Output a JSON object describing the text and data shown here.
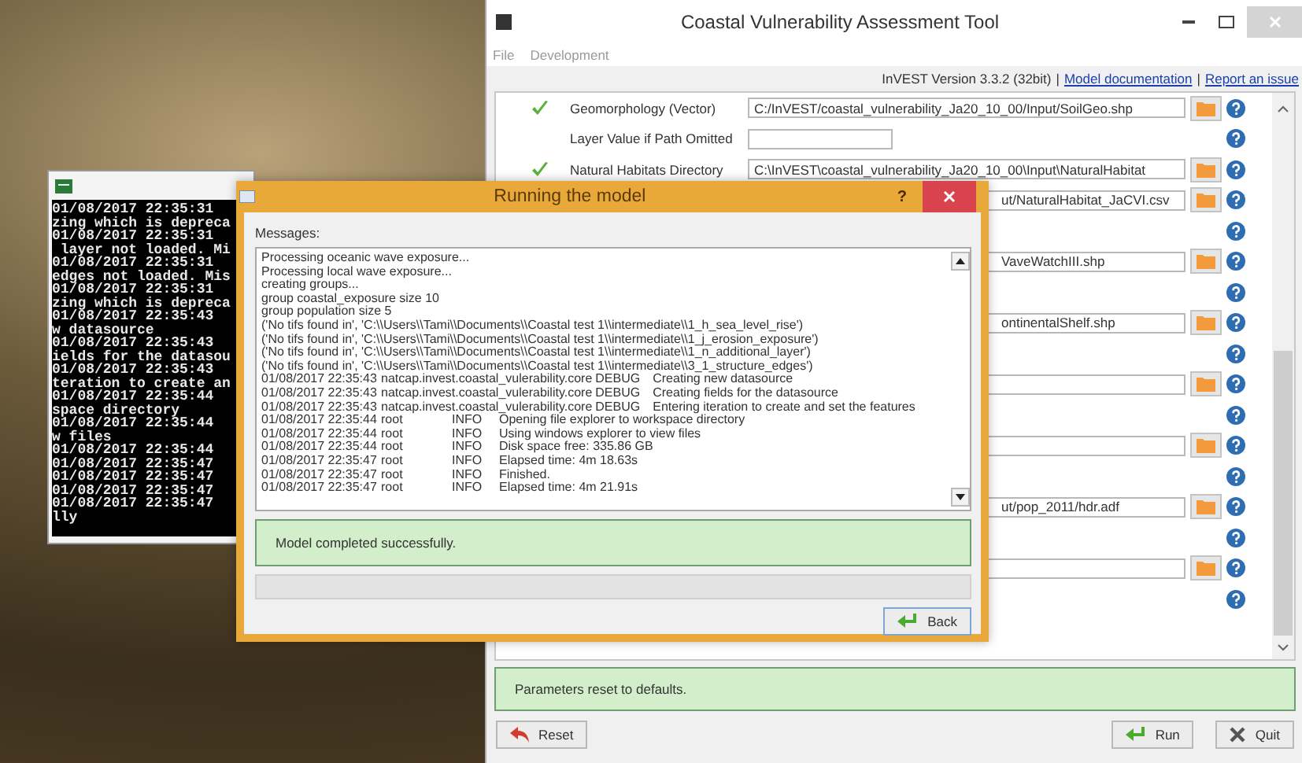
{
  "console": {
    "lines": [
      "01/08/2017 22:35:31",
      "zing which is depreca",
      "01/08/2017 22:35:31",
      " layer not loaded. Mi",
      "01/08/2017 22:35:31",
      "edges not loaded. Mis",
      "01/08/2017 22:35:31",
      "zing which is depreca",
      "01/08/2017 22:35:43",
      "w datasource",
      "01/08/2017 22:35:43",
      "ields for the datasou",
      "01/08/2017 22:35:43",
      "teration to create an",
      "01/08/2017 22:35:44",
      "space directory",
      "01/08/2017 22:35:44",
      "w files",
      "01/08/2017 22:35:44",
      "01/08/2017 22:35:47",
      "01/08/2017 22:35:47",
      "01/08/2017 22:35:47",
      "01/08/2017 22:35:47",
      "lly"
    ]
  },
  "tool_window": {
    "title": "Coastal Vulnerability Assessment Tool",
    "menu": [
      "File",
      "Development"
    ],
    "version": "InVEST Version 3.3.2 (32bit)",
    "separator": "|",
    "links": [
      "Model documentation",
      "Report an issue"
    ],
    "rows": [
      {
        "kind": "path",
        "label": "Geomorphology (Vector)",
        "checked": true,
        "value": "C:/InVEST/coastal_vulnerability_Ja20_10_00/Input/SoilGeo.shp"
      },
      {
        "kind": "value",
        "label": "Layer Value if Path Omitted",
        "checked": false
      },
      {
        "kind": "path",
        "label": "Natural Habitats Directory",
        "checked": true,
        "value": "C:\\InVEST\\coastal_vulnerability_Ja20_10_00\\Input\\NaturalHabitat"
      },
      {
        "kind": "field",
        "value": "ut/NaturalHabitat_JaCVI.csv"
      },
      {
        "kind": "help"
      },
      {
        "kind": "field",
        "value": "VaveWatchIII.shp"
      },
      {
        "kind": "help"
      },
      {
        "kind": "field",
        "value": "ontinentalShelf.shp"
      },
      {
        "kind": "help"
      },
      {
        "kind": "field"
      },
      {
        "kind": "help"
      },
      {
        "kind": "field"
      },
      {
        "kind": "help"
      },
      {
        "kind": "field",
        "value": "ut/pop_2011/hdr.adf"
      },
      {
        "kind": "help"
      },
      {
        "kind": "field"
      },
      {
        "kind": "help"
      }
    ],
    "status": "Parameters reset to defaults.",
    "buttons": {
      "reset": "Reset",
      "run": "Run",
      "quit": "Quit"
    }
  },
  "dialog": {
    "title": "Running the model",
    "help": "?",
    "messages_label": "Messages:",
    "messages": [
      {
        "kind": "text",
        "text": "Processing oceanic wave exposure..."
      },
      {
        "kind": "text",
        "text": "Processing local wave exposure..."
      },
      {
        "kind": "text",
        "text": "creating groups..."
      },
      {
        "kind": "text",
        "text": "group coastal_exposure size 10"
      },
      {
        "kind": "text",
        "text": "group population size 5"
      },
      {
        "kind": "text",
        "text": "('No tifs found in', 'C:\\\\Users\\\\Tami\\\\Documents\\\\Coastal test 1\\\\intermediate\\\\1_h_sea_level_rise')"
      },
      {
        "kind": "text",
        "text": "('No tifs found in', 'C:\\\\Users\\\\Tami\\\\Documents\\\\Coastal test 1\\\\intermediate\\\\1_j_erosion_exposure')"
      },
      {
        "kind": "text",
        "text": "('No tifs found in', 'C:\\\\Users\\\\Tami\\\\Documents\\\\Coastal test 1\\\\intermediate\\\\1_n_additional_layer')"
      },
      {
        "kind": "text",
        "text": "('No tifs found in', 'C:\\\\Users\\\\Tami\\\\Documents\\\\Coastal test 1\\\\intermediate\\\\3_1_structure_edges')"
      },
      {
        "kind": "log",
        "time": "01/08/2017 22:35:43",
        "source": "natcap.invest.coastal_vulerability.core",
        "level": "DEBUG",
        "message": "Creating new datasource"
      },
      {
        "kind": "log",
        "time": "01/08/2017 22:35:43",
        "source": "natcap.invest.coastal_vulerability.core",
        "level": "DEBUG",
        "message": "Creating fields for the datasource"
      },
      {
        "kind": "log",
        "time": "01/08/2017 22:35:43",
        "source": "natcap.invest.coastal_vulerability.core",
        "level": "DEBUG",
        "message": "Entering iteration to create and set the features"
      },
      {
        "kind": "log",
        "time": "01/08/2017 22:35:44",
        "source": "root",
        "level": "INFO",
        "message": "Opening file explorer to workspace directory"
      },
      {
        "kind": "log",
        "time": "01/08/2017 22:35:44",
        "source": "root",
        "level": "INFO",
        "message": "Using windows explorer to view files"
      },
      {
        "kind": "log",
        "time": "01/08/2017 22:35:44",
        "source": "root",
        "level": "INFO",
        "message": "Disk space free: 335.86 GB"
      },
      {
        "kind": "log",
        "time": "01/08/2017 22:35:47",
        "source": "root",
        "level": "INFO",
        "message": "Elapsed time: 4m 18.63s"
      },
      {
        "kind": "log",
        "time": "01/08/2017 22:35:47",
        "source": "root",
        "level": "INFO",
        "message": "Finished."
      },
      {
        "kind": "log",
        "time": "01/08/2017 22:35:47",
        "source": "root",
        "level": "INFO",
        "message": "Elapsed time: 4m 21.91s"
      }
    ],
    "status": "Model completed successfully.",
    "back": "Back"
  }
}
